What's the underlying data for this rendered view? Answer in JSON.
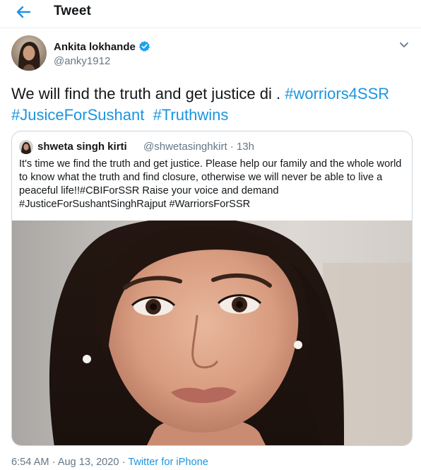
{
  "header": {
    "title": "Tweet",
    "back_icon": "arrow-left-icon"
  },
  "tweet": {
    "author_name": "Ankita lokhande",
    "author_handle": "@anky1912",
    "verified_icon": "verified-badge-icon",
    "more_icon": "chevron-down-icon",
    "text": "We will find the truth and get justice di . ",
    "hashtags": [
      "#worriors4SSR",
      "#JusiceForSushant",
      "#Truthwins"
    ],
    "timestamp": "6:54 AM · Aug 13, 2020 · ",
    "source": "Twitter for iPhone"
  },
  "quote": {
    "author_name": "shweta singh kirti",
    "author_handle": "@shwetasinghkirt",
    "time_ago": "· 13h",
    "text": "It's time we find the truth and get justice. Please help our family and the whole world to know what the truth and find closure, otherwise we will never be able to live a peaceful life!!#CBIForSSR Raise your voice and demand #JusticeForSushantSinghRajput #WarriorsForSSR"
  },
  "colors": {
    "accent": "#1b95e0",
    "verified": "#1da1f2",
    "text_primary": "#14171a",
    "text_secondary": "#657786",
    "border": "#ccd6dd"
  }
}
